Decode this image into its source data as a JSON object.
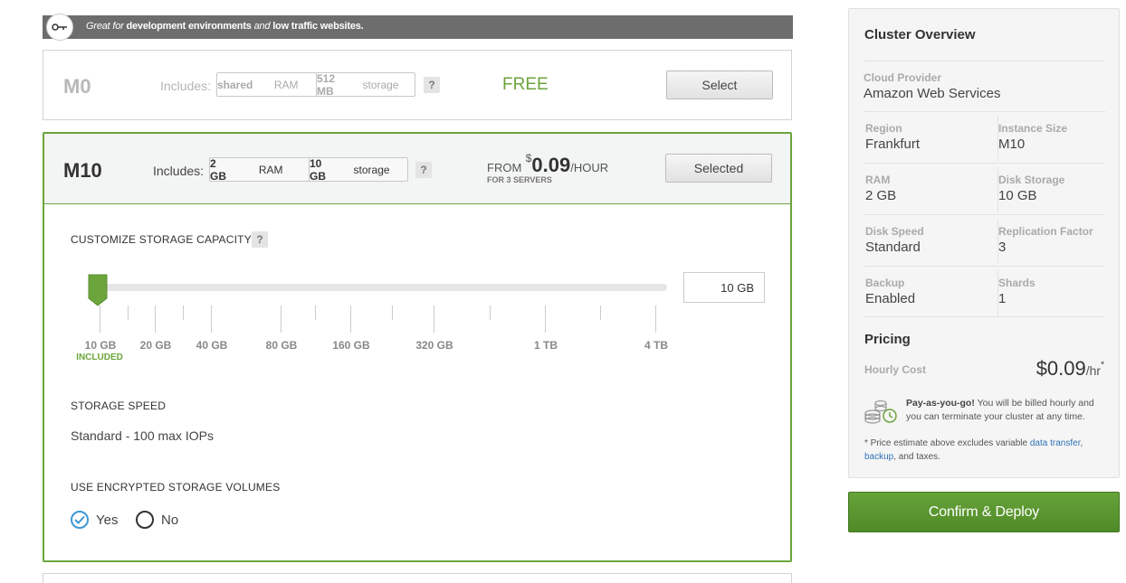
{
  "banner": {
    "italic1": "Great for",
    "bold1": "development environments",
    "italic2": "and",
    "bold2": "low traffic websites."
  },
  "tiers": {
    "m0": {
      "name": "M0",
      "includes_label": "Includes:",
      "ram_value": "shared",
      "ram_unit": "RAM",
      "storage_value": "512 MB",
      "storage_unit": "storage",
      "help": "?",
      "price": "FREE",
      "button": "Select"
    },
    "m10": {
      "name": "M10",
      "includes_label": "Includes:",
      "ram_value": "2 GB",
      "ram_unit": "RAM",
      "storage_value": "10 GB",
      "storage_unit": "storage",
      "help": "?",
      "price_from": "FROM",
      "price_currency": "$",
      "price_amount": "0.09",
      "price_unit": "/HOUR",
      "price_note": "FOR 3 SERVERS",
      "button": "Selected"
    }
  },
  "storage": {
    "title": "CUSTOMIZE STORAGE CAPACITY",
    "help": "?",
    "value": "10 GB",
    "slider_level": 0,
    "ticks": [
      "10 GB",
      "20 GB",
      "40 GB",
      "80 GB",
      "160 GB",
      "320 GB",
      "1 TB",
      "4 TB"
    ],
    "included_label": "INCLUDED"
  },
  "storage_speed": {
    "title": "STORAGE SPEED",
    "value": "Standard - 100 max IOPs"
  },
  "encryption": {
    "title": "USE ENCRYPTED STORAGE VOLUMES",
    "yes": "Yes",
    "no": "No",
    "selected": "Yes"
  },
  "overview": {
    "title": "Cluster Overview",
    "cloud_provider_label": "Cloud Provider",
    "cloud_provider": "Amazon Web Services",
    "region_label": "Region",
    "region": "Frankfurt",
    "instance_size_label": "Instance Size",
    "instance_size": "M10",
    "ram_label": "RAM",
    "ram": "2 GB",
    "disk_storage_label": "Disk Storage",
    "disk_storage": "10 GB",
    "disk_speed_label": "Disk Speed",
    "disk_speed": "Standard",
    "replication_label": "Replication Factor",
    "replication": "3",
    "backup_label": "Backup",
    "backup": "Enabled",
    "shards_label": "Shards",
    "shards": "1"
  },
  "pricing": {
    "title": "Pricing",
    "hourly_label": "Hourly Cost",
    "hourly_value": "$0.09",
    "hourly_unit": "/hr",
    "asterisk": "*",
    "payg_bold": "Pay-as-you-go!",
    "payg_text": " You will be billed hourly and you can terminate your cluster at any time.",
    "footnote_text": "* Price estimate above excludes variable ",
    "link_data_transfer": "data transfer",
    "comma": ",",
    "link_backup": "backup",
    "footnote_end": ", and taxes."
  },
  "deploy_button": "Confirm & Deploy",
  "colors": {
    "accent_green": "#6ba53b",
    "radio_blue": "#3d97d6",
    "link_blue": "#2f73b7"
  }
}
